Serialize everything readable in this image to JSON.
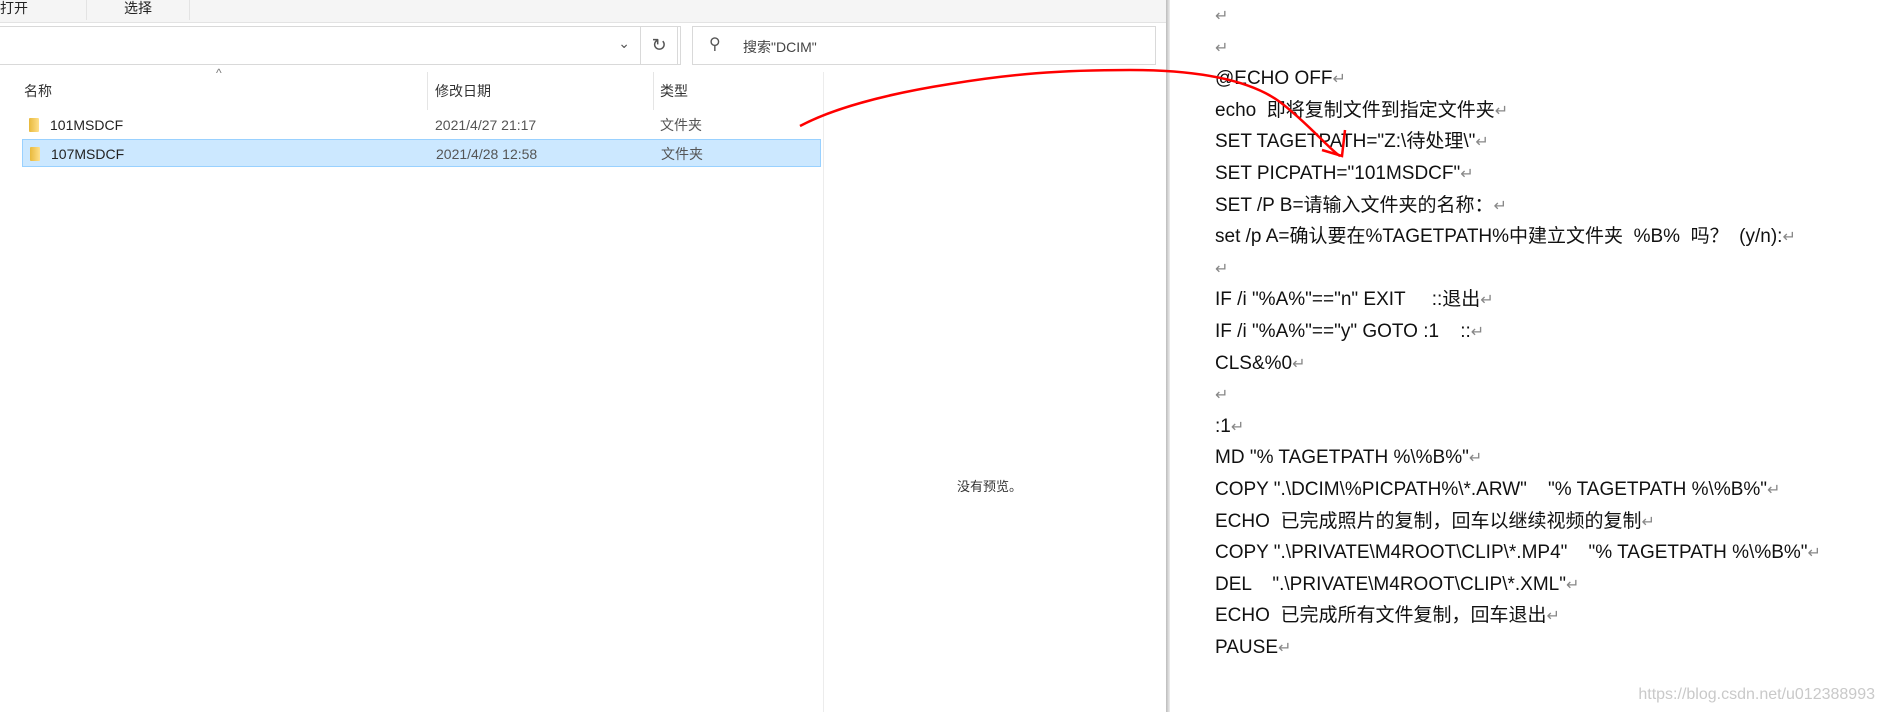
{
  "ribbon": {
    "open": "打开",
    "select": "选择"
  },
  "search": {
    "placeholder": "搜索\"DCIM\"",
    "icon": "search-icon"
  },
  "refresh_icon": "↻",
  "columns": {
    "name": "名称",
    "date": "修改日期",
    "type": "类型"
  },
  "files": [
    {
      "name": "101MSDCF",
      "date": "2021/4/27 21:17",
      "type": "文件夹",
      "selected": false
    },
    {
      "name": "107MSDCF",
      "date": "2021/4/28 12:58",
      "type": "文件夹",
      "selected": true
    }
  ],
  "preview": {
    "text": "没有预览。"
  },
  "document": {
    "pilcrow": "↵",
    "lines": [
      "",
      "",
      "@ECHO OFF",
      "echo  即将复制文件到指定文件夹",
      "SET TAGETPATH=\"Z:\\待处理\\\"",
      "SET PICPATH=\"101MSDCF\"",
      "SET /P B=请输入文件夹的名称：",
      "set /p A=确认要在%TAGETPATH%中建立文件夹  %B%  吗？  (y/n):",
      "",
      "IF /i \"%A%\"==\"n\" EXIT     ::退出",
      "IF /i \"%A%\"==\"y\" GOTO :1    ::",
      "CLS&%0",
      "",
      ":1",
      "MD \"% TAGETPATH %\\%B%\"",
      "COPY \".\\DCIM\\%PICPATH%\\*.ARW\"    \"% TAGETPATH %\\%B%\"",
      "ECHO  已完成照片的复制，回车以继续视频的复制",
      "COPY \".\\PRIVATE\\M4ROOT\\CLIP\\*.MP4\"    \"% TAGETPATH %\\%B%\"",
      "DEL    \".\\PRIVATE\\M4ROOT\\CLIP\\*.XML\"",
      "ECHO  已完成所有文件复制，回车退出",
      "PAUSE"
    ],
    "watermark": "https://blog.csdn.net/u012388993"
  },
  "annotation_color": "#ff0000"
}
